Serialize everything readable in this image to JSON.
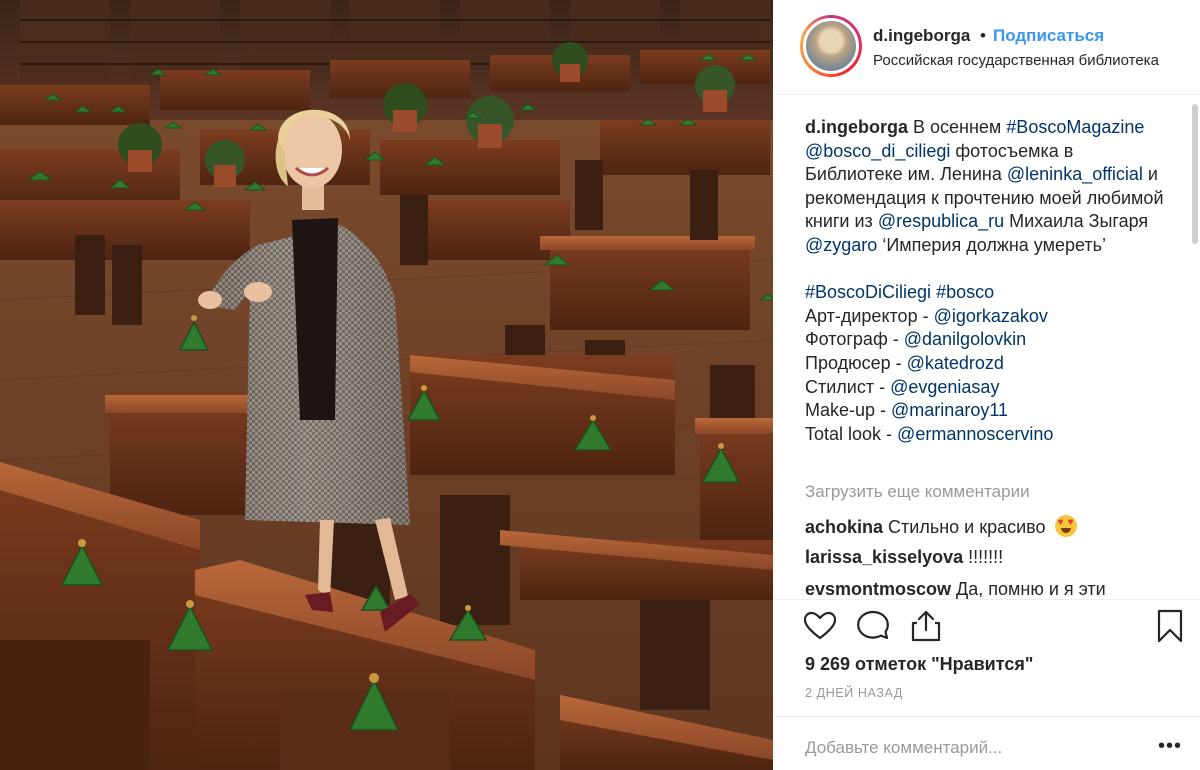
{
  "post": {
    "image_alt": "Фото в читальном зале"
  },
  "header": {
    "username": "d.ingeborga",
    "separator": "•",
    "follow_label": "Подписаться",
    "location": "Российская государственная библиотека"
  },
  "caption": {
    "username": "d.ingeborga",
    "parts": {
      "p1": " В осеннем ",
      "h1": "#BoscoMagazine",
      "m1": "@bosco_di_ciliegi",
      "p2": " фотосъемка в Библиотеке им. Ленина ",
      "m2": "@leninka_official",
      "p3": " и рекомендация к прочтению моей любимой книги из ",
      "m3": "@respublica_ru",
      "p4": " Михаила Зыгаря ",
      "m4": "@zygaro",
      "p5": " ‘Империя должна умереть’",
      "h2": "#BoscoDiCiliegi",
      "h3": "#bosco",
      "art_label": "Арт-директор - ",
      "art_handle": "@igorkazakov",
      "photo_label": "Фотограф - ",
      "photo_handle": "@danilgolovkin",
      "prod_label": "Продюсер - ",
      "prod_handle": "@katedrozd",
      "style_label": "Стилист - ",
      "style_handle": "@evgeniasay",
      "makeup_label": "Make-up - ",
      "makeup_handle": "@marinaroy11",
      "look_label": "Total look - ",
      "look_handle": "@ermannoscervino"
    }
  },
  "load_more": "Загрузить еще комментарии",
  "comments": [
    {
      "username": "achokina",
      "text": " Стильно и красиво ",
      "emoji": "heart-eyes-emoji"
    },
    {
      "username": "larissa_kisselyova",
      "text": " !!!!!!!"
    },
    {
      "username": "evsmontmoscow",
      "text": " Да, помню и я эти"
    }
  ],
  "actions": {
    "like_icon": "heart-icon",
    "comment_icon": "comment-bubble-icon",
    "share_icon": "share-icon",
    "save_icon": "bookmark-icon"
  },
  "likes_text": "9 269 отметок \"Нравится\"",
  "timestamp": "2 ДНЕЙ НАЗАД",
  "add_comment": {
    "placeholder": "Добавьте комментарий...",
    "more_label": "•••"
  },
  "colors": {
    "link": "#003569",
    "follow": "#3897f0",
    "muted": "#999999",
    "text": "#262626"
  }
}
